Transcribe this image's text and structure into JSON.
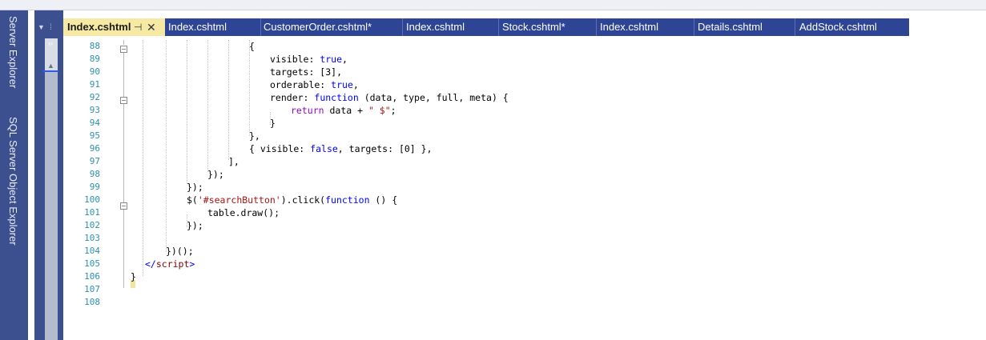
{
  "side_panels": [
    "Server Explorer",
    "SQL Server Object Explorer"
  ],
  "tabs": [
    {
      "label": "Index.cshtml",
      "active": true
    },
    {
      "label": "Index.cshtml"
    },
    {
      "label": "CustomerOrder.cshtml*"
    },
    {
      "label": "Index.cshtml"
    },
    {
      "label": "Stock.cshtml*"
    },
    {
      "label": "Index.cshtml"
    },
    {
      "label": "Details.cshtml"
    },
    {
      "label": "AddStock.cshtml"
    }
  ],
  "tab_icons": {
    "pin": "pin-icon",
    "close": "close-icon"
  },
  "colors": {
    "tab_bar": "#2e4596",
    "active_tab": "#f5e9a3",
    "side_bar": "#3c4f8f",
    "line_number": "#2b91af",
    "keyword": "#0000ff",
    "string": "#a31515"
  },
  "code": {
    "line_numbers": [
      "88",
      "89",
      "90",
      "91",
      "92",
      "93",
      "94",
      "95",
      "96",
      "97",
      "98",
      "99",
      "100",
      "101",
      "102",
      "103",
      "104",
      "105",
      "106",
      "107",
      "108"
    ],
    "lines": [
      {
        "parts": [
          {
            "t": "{",
            "c": ""
          }
        ]
      },
      {
        "parts": [
          {
            "t": "visible: ",
            "c": ""
          },
          {
            "t": "true",
            "c": "kw"
          },
          {
            "t": ",",
            "c": ""
          }
        ]
      },
      {
        "parts": [
          {
            "t": "targets: [3],",
            "c": ""
          }
        ]
      },
      {
        "parts": [
          {
            "t": "orderable: ",
            "c": ""
          },
          {
            "t": "true",
            "c": "kw"
          },
          {
            "t": ",",
            "c": ""
          }
        ]
      },
      {
        "parts": [
          {
            "t": "render: ",
            "c": ""
          },
          {
            "t": "function",
            "c": "kw"
          },
          {
            "t": " (data, type, full, meta) {",
            "c": ""
          }
        ]
      },
      {
        "parts": [
          {
            "t": "return",
            "c": "kwp"
          },
          {
            "t": " data + ",
            "c": ""
          },
          {
            "t": "\" $\"",
            "c": "str"
          },
          {
            "t": ";",
            "c": ""
          }
        ]
      },
      {
        "parts": [
          {
            "t": "}",
            "c": ""
          }
        ]
      },
      {
        "parts": [
          {
            "t": "},",
            "c": ""
          }
        ]
      },
      {
        "parts": [
          {
            "t": "{ visible: ",
            "c": ""
          },
          {
            "t": "false",
            "c": "kw"
          },
          {
            "t": ", targets: [0] },",
            "c": ""
          }
        ]
      },
      {
        "parts": [
          {
            "t": "],",
            "c": ""
          }
        ]
      },
      {
        "parts": [
          {
            "t": "});",
            "c": ""
          }
        ]
      },
      {
        "parts": [
          {
            "t": "});",
            "c": ""
          }
        ]
      },
      {
        "parts": [
          {
            "t": "$(",
            "c": ""
          },
          {
            "t": "'#searchButton'",
            "c": "str"
          },
          {
            "t": ").click(",
            "c": ""
          },
          {
            "t": "function",
            "c": "kw"
          },
          {
            "t": " () {",
            "c": ""
          }
        ]
      },
      {
        "parts": [
          {
            "t": "table.draw();",
            "c": ""
          }
        ]
      },
      {
        "parts": [
          {
            "t": "});",
            "c": ""
          }
        ]
      },
      {
        "parts": []
      },
      {
        "parts": [
          {
            "t": "})();",
            "c": ""
          }
        ]
      },
      {
        "parts": [
          {
            "t": "</",
            "c": "kw"
          },
          {
            "t": "script",
            "c": "tag"
          },
          {
            "t": ">",
            "c": "kw"
          }
        ]
      },
      {
        "parts": [
          {
            "t": "}",
            "c": ""
          }
        ]
      },
      {
        "parts": []
      },
      {
        "parts": []
      }
    ]
  }
}
